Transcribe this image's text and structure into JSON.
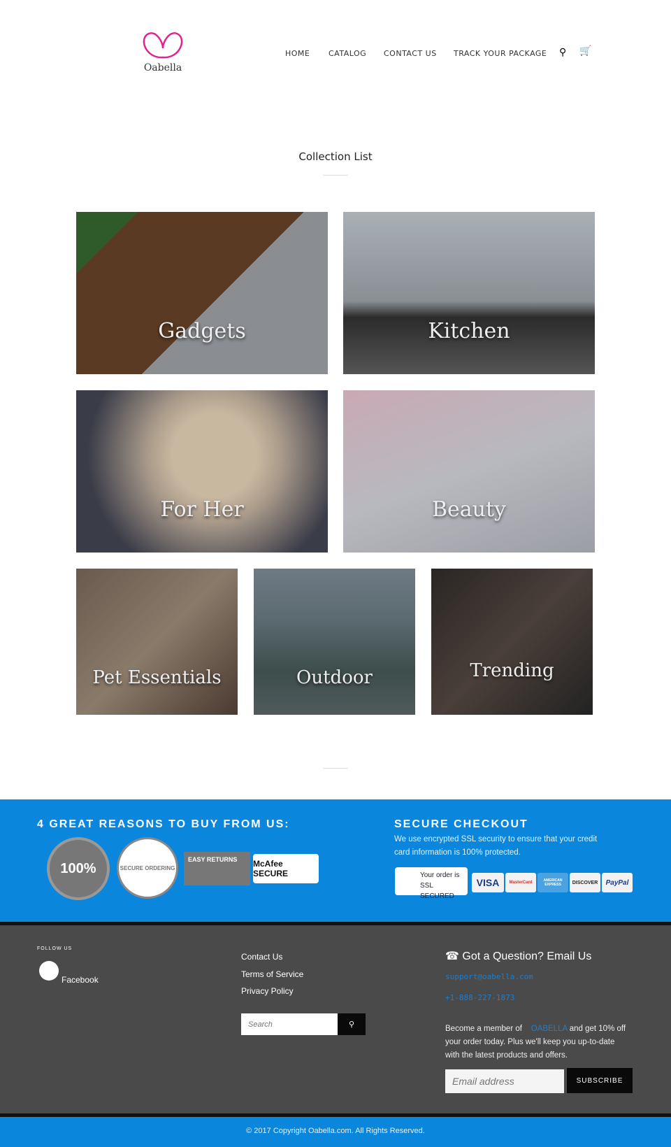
{
  "header": {
    "logo": "Oabella",
    "nav": [
      "HOME",
      "CATALOG",
      "CONTACT US",
      "TRACK YOUR PACKAGE"
    ]
  },
  "main": {
    "title": "Collection List",
    "collections": [
      "Gadgets",
      "Kitchen",
      "For Her",
      "Beauty",
      "Pet Essentials",
      "Outdoor",
      "Trending"
    ]
  },
  "reasons": {
    "title": "4 GREAT REASONS TO BUY FROM US:",
    "badges": [
      "100%",
      "SECURE ORDERING",
      "EASY RETURNS",
      "McAfee SECURE"
    ]
  },
  "checkout": {
    "title": "SECURE CHECKOUT",
    "text": "We use encrypted SSL security to ensure that your credit card information is 100% protected.",
    "ssl": "Your order is SSL SECURED",
    "cards": [
      "VISA",
      "MasterCard",
      "AMERICAN EXPRESS",
      "DISCOVER",
      "PayPal"
    ]
  },
  "footer": {
    "follow": "FOLLOW US",
    "facebook": "Facebook",
    "links": [
      "Contact Us",
      "Terms of Service",
      "Privacy Policy"
    ],
    "search_placeholder": "Search",
    "question": "Got a Question? Email Us",
    "email": "support@oabella.com",
    "phone": "+1-888-227-1873",
    "member_pre": "Become a member of",
    "brand": "OABELLA",
    "member_post": "and get 10% off your order today. Plus we'll keep you up-to-date with the latest products and offers.",
    "email_placeholder": "Email address",
    "subscribe": "SUBSCRIBE",
    "copyright": "© 2017 Copyright Oabella.com. All Rights Reserved."
  },
  "colors": {
    "accent": "#0a86dc",
    "logo": "#e0228e",
    "footer_bg": "#4a4a4a"
  }
}
